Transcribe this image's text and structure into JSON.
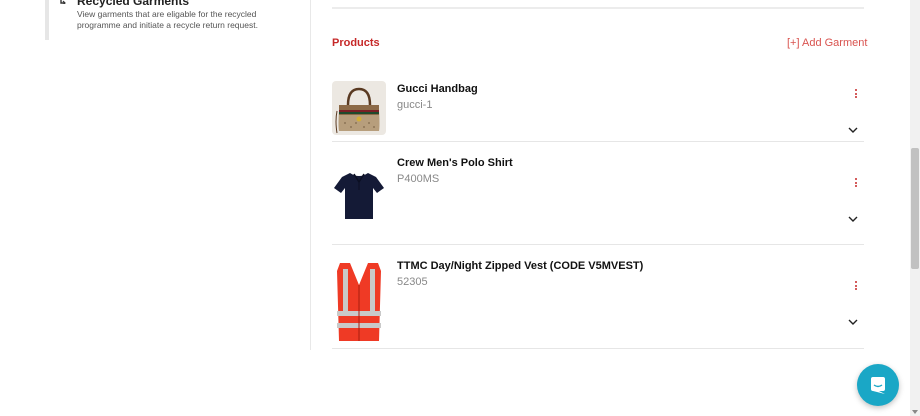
{
  "sidebar": {
    "section_title": "Recycled Garments",
    "section_description": "View garments that are eligable for the recycled programme and initiate a recycle return request."
  },
  "products": {
    "heading": "Products",
    "add_label": "[+] Add Garment",
    "items": [
      {
        "name": "Gucci Handbag",
        "code": "gucci-1",
        "thumb_icon": "handbag-image"
      },
      {
        "name": "Crew Men's Polo Shirt",
        "code": "P400MS",
        "thumb_icon": "polo-shirt-image"
      },
      {
        "name": "TTMC Day/Night Zipped Vest (CODE V5MVEST)",
        "code": "52305",
        "thumb_icon": "hi-vis-vest-image"
      }
    ]
  },
  "colors": {
    "accent_red": "#c62828",
    "chat_button": "#1aa7c6"
  }
}
